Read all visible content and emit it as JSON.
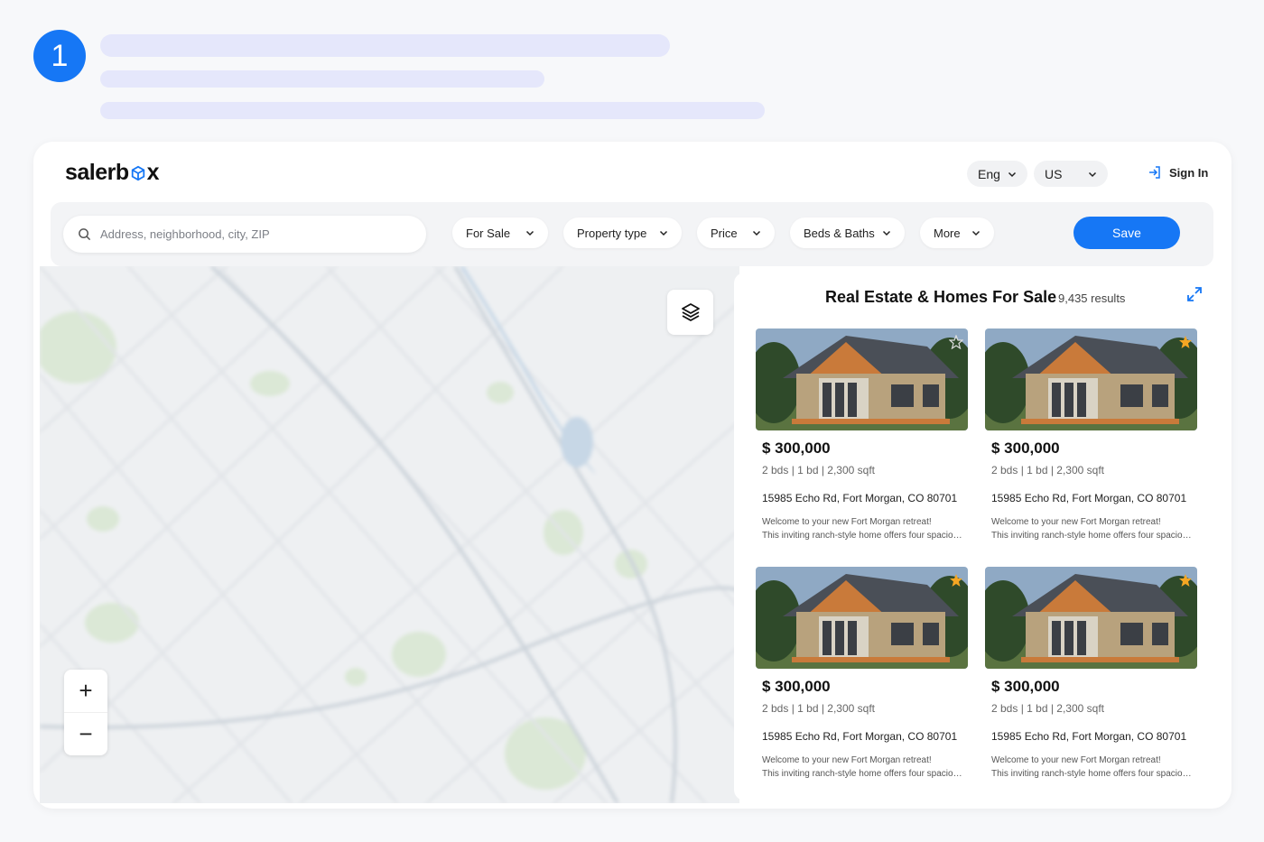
{
  "step": {
    "number": "1"
  },
  "header": {
    "logo_text": [
      "salerb",
      "x"
    ],
    "language": "Eng",
    "country": "US",
    "signin_label": "Sign In"
  },
  "filters": {
    "search_placeholder": "Address, neighborhood, city, ZIP",
    "for_sale": "For Sale",
    "property_type": "Property type",
    "price": "Price",
    "beds_baths": "Beds & Baths",
    "more": "More",
    "save_label": "Save"
  },
  "map": {
    "zoom_in": "+",
    "zoom_out": "−"
  },
  "listings": {
    "title": "Real Estate & Homes For Sale",
    "count": "9,435 results",
    "items": [
      {
        "price": "$ 300,000",
        "specs": "2 bds | 1 bd | 2,300 sqft",
        "address": "15985 Echo Rd, Fort Morgan, CO 80701",
        "desc1": "Welcome to your new Fort Morgan retreat!",
        "desc2": "This inviting ranch-style home offers four spacious...",
        "favorite": false
      },
      {
        "price": "$ 300,000",
        "specs": "2 bds | 1 bd | 2,300 sqft",
        "address": "15985 Echo Rd, Fort Morgan, CO 80701",
        "desc1": "Welcome to your new Fort Morgan retreat!",
        "desc2": "This inviting ranch-style home offers four spacious...",
        "favorite": true
      },
      {
        "price": "$ 300,000",
        "specs": "2 bds | 1 bd | 2,300 sqft",
        "address": "15985 Echo Rd, Fort Morgan, CO 80701",
        "desc1": "Welcome to your new Fort Morgan retreat!",
        "desc2": "This inviting ranch-style home offers four spacious...",
        "favorite": true
      },
      {
        "price": "$ 300,000",
        "specs": "2 bds | 1 bd | 2,300 sqft",
        "address": "15985 Echo Rd, Fort Morgan, CO 80701",
        "desc1": "Welcome to your new Fort Morgan retreat!",
        "desc2": "This inviting ranch-style home offers four spacious...",
        "favorite": true
      }
    ]
  },
  "colors": {
    "accent": "#1677f5",
    "star": "#f5a623",
    "skeleton": "#e5e7fb"
  },
  "icons": {
    "search": "search-icon",
    "signin": "sign-in-icon",
    "layers": "layers-icon",
    "expand": "expand-icon",
    "favorite": "star-icon",
    "logo_box": "cube-icon"
  }
}
